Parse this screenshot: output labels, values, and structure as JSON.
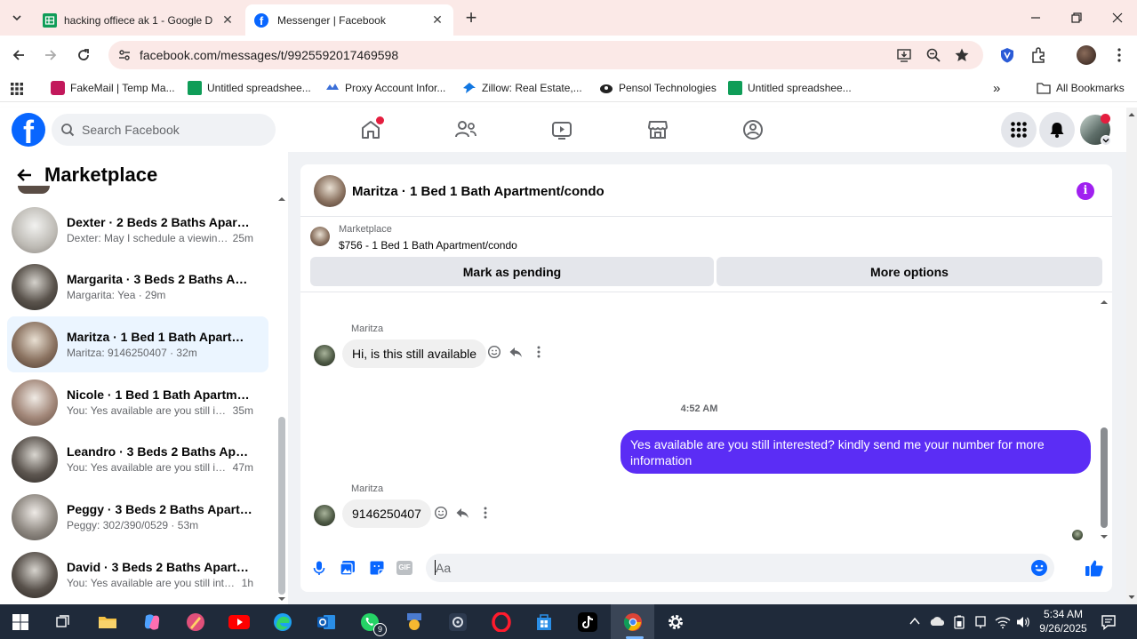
{
  "browser": {
    "tabs": [
      {
        "title": "hacking offiece ak 1 - Google D",
        "icon": "google-sheets-icon"
      },
      {
        "title": "Messenger | Facebook",
        "icon": "facebook-icon"
      }
    ],
    "url": "facebook.com/messages/t/9925592017469598",
    "bookmarks": [
      {
        "label": "FakeMail | Temp Ma..."
      },
      {
        "label": "Untitled spreadshee..."
      },
      {
        "label": "Proxy Account Infor..."
      },
      {
        "label": "Zillow: Real Estate,..."
      },
      {
        "label": "Pensol Technologies"
      },
      {
        "label": "Untitled spreadshee..."
      }
    ],
    "all_bookmarks": "All Bookmarks"
  },
  "facebook": {
    "search_placeholder": "Search Facebook"
  },
  "sidebar": {
    "title": "Marketplace",
    "conversations": [
      {
        "name": "Dexter · 2 Beds 2 Baths Apartm...",
        "preview": "Dexter: May I schedule a viewing ...",
        "time": "25m"
      },
      {
        "name": "Margarita · 3 Beds 2 Baths Apar...",
        "preview": "Margarita: Yea · 29m",
        "time": ""
      },
      {
        "name": "Maritza · 1 Bed 1 Bath Apartmen...",
        "preview": "Maritza: 9146250407 · 32m",
        "time": ""
      },
      {
        "name": "Nicole · 1 Bed 1 Bath Apartment...",
        "preview": "You: Yes available are you still int...",
        "time": "35m"
      },
      {
        "name": "Leandro · 3 Beds 2 Baths Apart...",
        "preview": "You: Yes available are you still int...",
        "time": "47m"
      },
      {
        "name": "Peggy · 3 Beds 2 Baths Apartme...",
        "preview": "Peggy: 302/390/0529 · 53m",
        "time": ""
      },
      {
        "name": "David · 3 Beds 2 Baths Apartme...",
        "preview": "You: Yes available are you still inter...",
        "time": "1h"
      }
    ]
  },
  "chat": {
    "title": "Maritza · 1 Bed 1 Bath Apartment/condo",
    "listing_label": "Marketplace",
    "listing_text": "$756 - 1 Bed 1 Bath Apartment/condo",
    "mark_pending": "Mark as pending",
    "more_options": "More options",
    "messages": [
      {
        "sender": "Maritza",
        "text": "Hi, is this still available"
      },
      {
        "timestamp": "4:52 AM"
      },
      {
        "sender": "You",
        "text": "Yes available are you still interested? kindly send me your number for more information"
      },
      {
        "sender": "Maritza",
        "text": "9146250407"
      }
    ],
    "composer_placeholder": "Aa"
  },
  "taskbar": {
    "time": "5:34 AM",
    "date": "9/26/2025",
    "whatsapp_badge": "9"
  },
  "colors": {
    "fb_blue": "#0866ff",
    "sent_bubble": "#5b2df5",
    "received_bubble": "#f0f0f0",
    "selected_row": "#ebf5ff"
  }
}
